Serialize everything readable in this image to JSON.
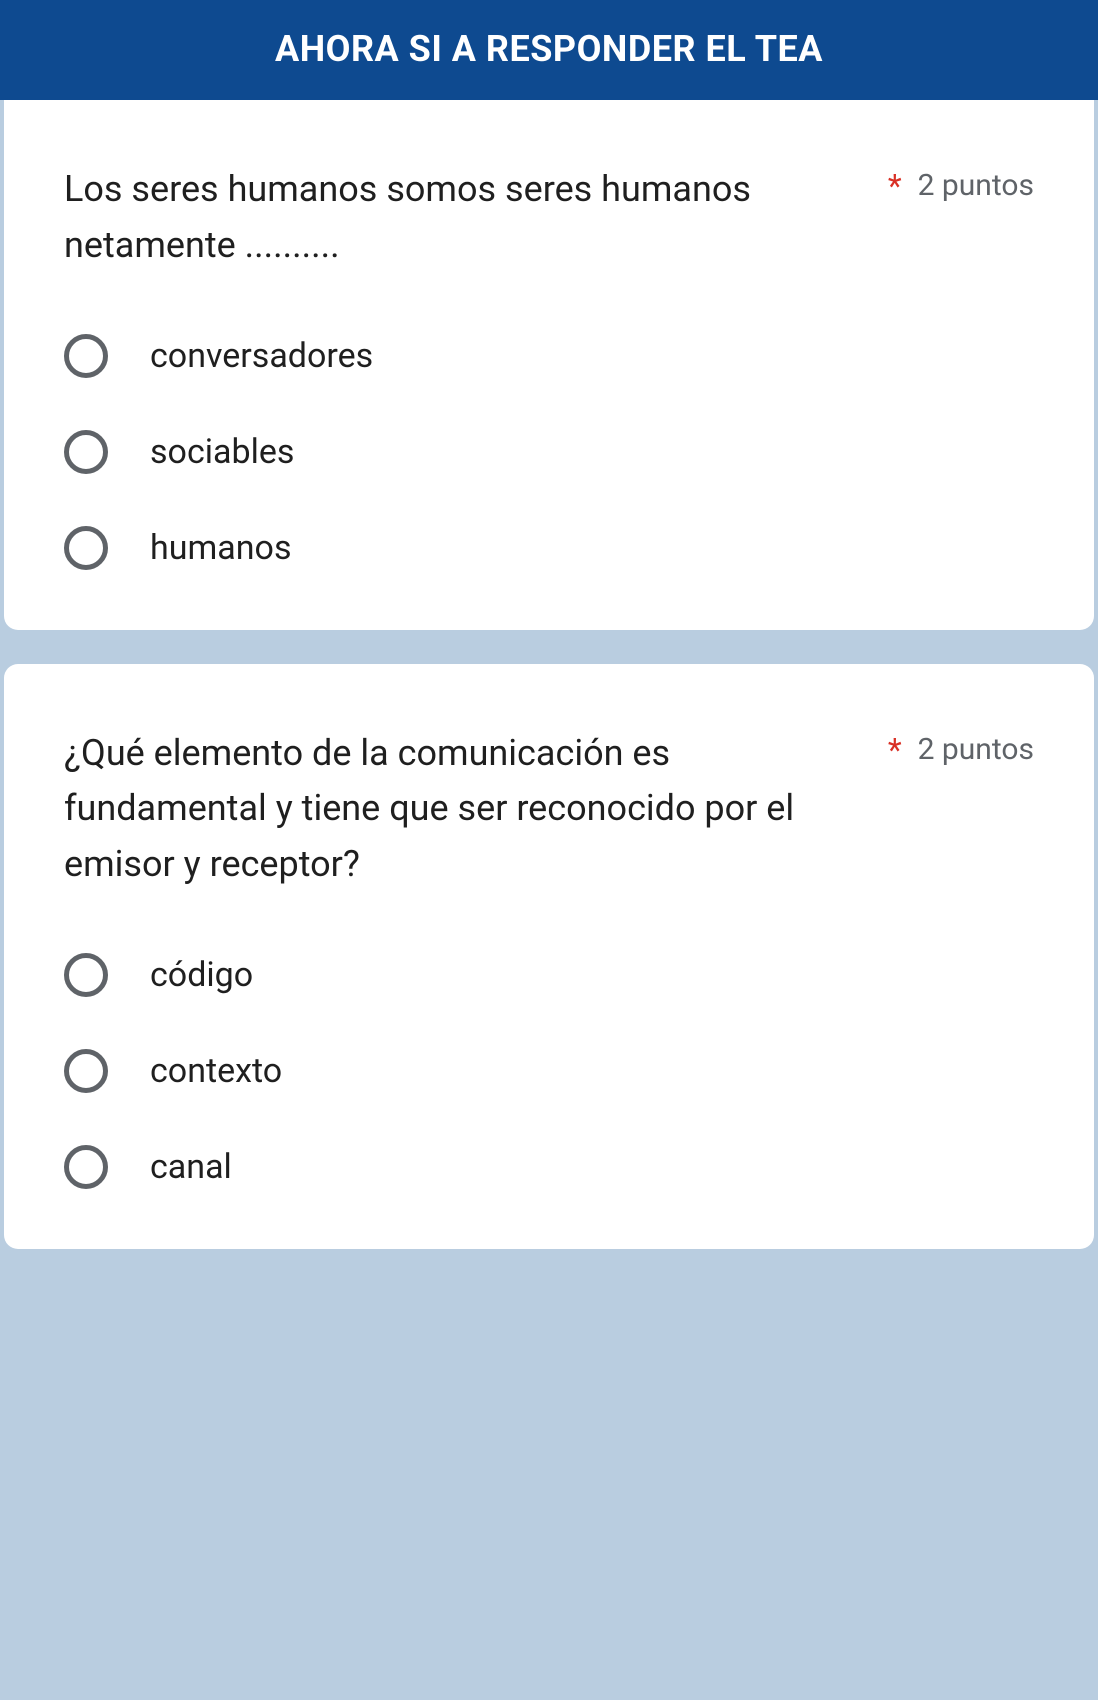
{
  "header": {
    "title": "AHORA SI A RESPONDER EL TEA"
  },
  "questions": [
    {
      "prompt": "Los seres humanos somos seres humanos netamente ..........",
      "required_mark": "*",
      "points": "2 puntos",
      "options": [
        "conversadores",
        "sociables",
        "humanos"
      ]
    },
    {
      "prompt": "¿Qué elemento de la comunicación es fundamental y tiene que ser reconocido por el emisor y receptor?",
      "required_mark": "*",
      "points": "2 puntos",
      "options": [
        "código",
        "contexto",
        "canal"
      ]
    }
  ]
}
